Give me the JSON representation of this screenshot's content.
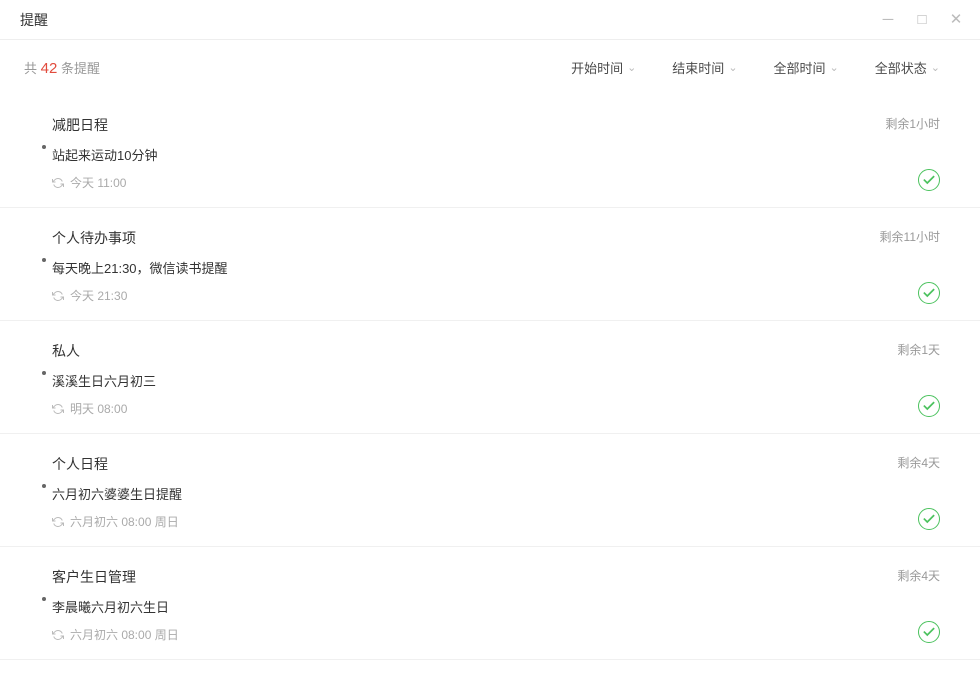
{
  "titlebar": {
    "title": "提醒"
  },
  "summary": {
    "prefix": "共",
    "count": "42",
    "suffix": "条提醒"
  },
  "filters": [
    {
      "label": "开始时间"
    },
    {
      "label": "结束时间"
    },
    {
      "label": "全部时间"
    },
    {
      "label": "全部状态"
    }
  ],
  "items": [
    {
      "title": "减肥日程",
      "content": "站起来运动10分钟",
      "time": "今天 11:00",
      "remaining": "剩余1小时"
    },
    {
      "title": "个人待办事项",
      "content": "每天晚上21:30，微信读书提醒",
      "time": "今天 21:30",
      "remaining": "剩余11小时"
    },
    {
      "title": "私人",
      "content": "溪溪生日六月初三",
      "time": "明天 08:00",
      "remaining": "剩余1天"
    },
    {
      "title": "个人日程",
      "content": "六月初六婆婆生日提醒",
      "time": "六月初六 08:00 周日",
      "remaining": "剩余4天"
    },
    {
      "title": "客户生日管理",
      "content": "李晨曦六月初六生日",
      "time": "六月初六 08:00 周日",
      "remaining": "剩余4天"
    }
  ]
}
